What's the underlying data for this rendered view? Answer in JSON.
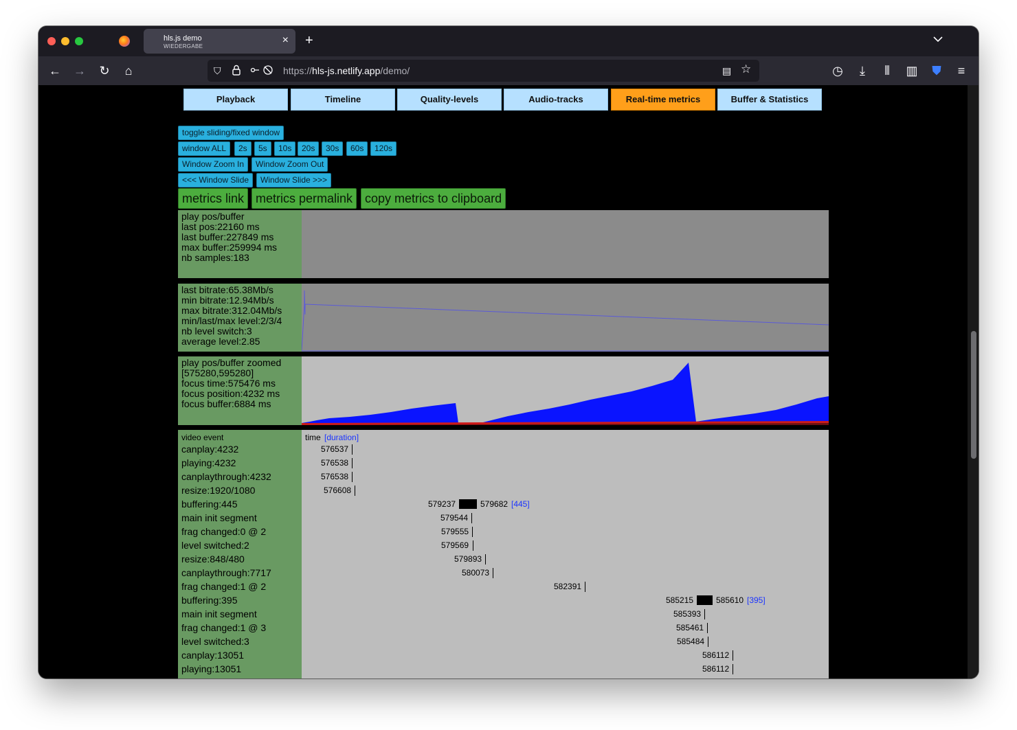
{
  "browser": {
    "tab": {
      "title": "hls.js demo",
      "subtitle": "WIEDERGABE",
      "close": "×"
    },
    "new_tab": "+",
    "tab_list": "⌄",
    "url": {
      "domain_prefix": "https://",
      "domain": "hls-js.netlify.app",
      "path": "/demo/"
    },
    "nav": {
      "back": "←",
      "forward": "→",
      "reload": "↻",
      "home": "⌂"
    },
    "icons": {
      "shield": "⛉",
      "lock": "🔒",
      "reader": "▤",
      "star": "☆",
      "history": "◷",
      "download": "⤓",
      "library": "⫴",
      "sidebar": "▥",
      "bitwarden": "⛊",
      "menu": "≡"
    }
  },
  "tabs": [
    "Playback",
    "Timeline",
    "Quality-levels",
    "Audio-tracks",
    "Real-time metrics",
    "Buffer & Statistics"
  ],
  "active_tab_index": 4,
  "controls": {
    "toggle": "toggle sliding/fixed window",
    "windows": [
      "window ALL",
      "2s",
      "5s",
      "10s",
      "20s",
      "30s",
      "60s",
      "120s"
    ],
    "zoom_in": "Window Zoom In",
    "zoom_out": "Window Zoom Out",
    "slide_left": "<<< Window Slide",
    "slide_right": "Window Slide >>>",
    "metrics_link": "metrics link",
    "metrics_permalink": "metrics permalink",
    "copy_metrics": "copy metrics to clipboard"
  },
  "buffer_panel": {
    "lines": [
      "play pos/buffer",
      "last pos:22160 ms",
      "last buffer:227849 ms",
      "max buffer:259994 ms",
      "nb samples:183"
    ]
  },
  "bitrate_panel": {
    "lines": [
      "last bitrate:65.38Mb/s",
      "min bitrate:12.94Mb/s",
      "max bitrate:312.04Mb/s",
      "min/last/max level:2/3/4",
      "nb level switch:3",
      "average level:2.85"
    ]
  },
  "zoom_panel": {
    "lines": [
      "play pos/buffer zoomed",
      "[575280,595280]",
      "focus time:575476 ms",
      "focus position:4232 ms",
      "focus buffer:6884 ms"
    ]
  },
  "events_panel": {
    "header_label": "video event",
    "header_time": "time",
    "header_duration": "[duration]",
    "events": [
      {
        "label": "canplay:4232",
        "time": "576537"
      },
      {
        "label": "playing:4232",
        "time": "576538"
      },
      {
        "label": "canplaythrough:4232",
        "time": "576538"
      },
      {
        "label": "resize:1920/1080",
        "time": "576608"
      },
      {
        "label": "buffering:445",
        "time": "579237",
        "end": "579682",
        "duration": "[445]"
      },
      {
        "label": "main init segment",
        "time": "579544"
      },
      {
        "label": "frag changed:0 @ 2",
        "time": "579555"
      },
      {
        "label": "level switched:2",
        "time": "579569"
      },
      {
        "label": "resize:848/480",
        "time": "579893"
      },
      {
        "label": "canplaythrough:7717",
        "time": "580073"
      },
      {
        "label": "frag changed:1 @ 2",
        "time": "582391"
      },
      {
        "label": "buffering:395",
        "time": "585215",
        "end": "585610",
        "duration": "[395]"
      },
      {
        "label": "main init segment",
        "time": "585393"
      },
      {
        "label": "frag changed:1 @ 3",
        "time": "585461"
      },
      {
        "label": "level switched:3",
        "time": "585484"
      },
      {
        "label": "canplay:13051",
        "time": "586112"
      },
      {
        "label": "playing:13051",
        "time": "586112"
      }
    ]
  },
  "colors": {
    "active_tab": "#ff9f1a",
    "tab": "#b6e0ff",
    "control_button": "#29b0de",
    "link_button": "#4cad3e",
    "label_bg": "#699a62",
    "buffer_fill": "#0a14ff",
    "position_line": "#cc1a1a"
  }
}
